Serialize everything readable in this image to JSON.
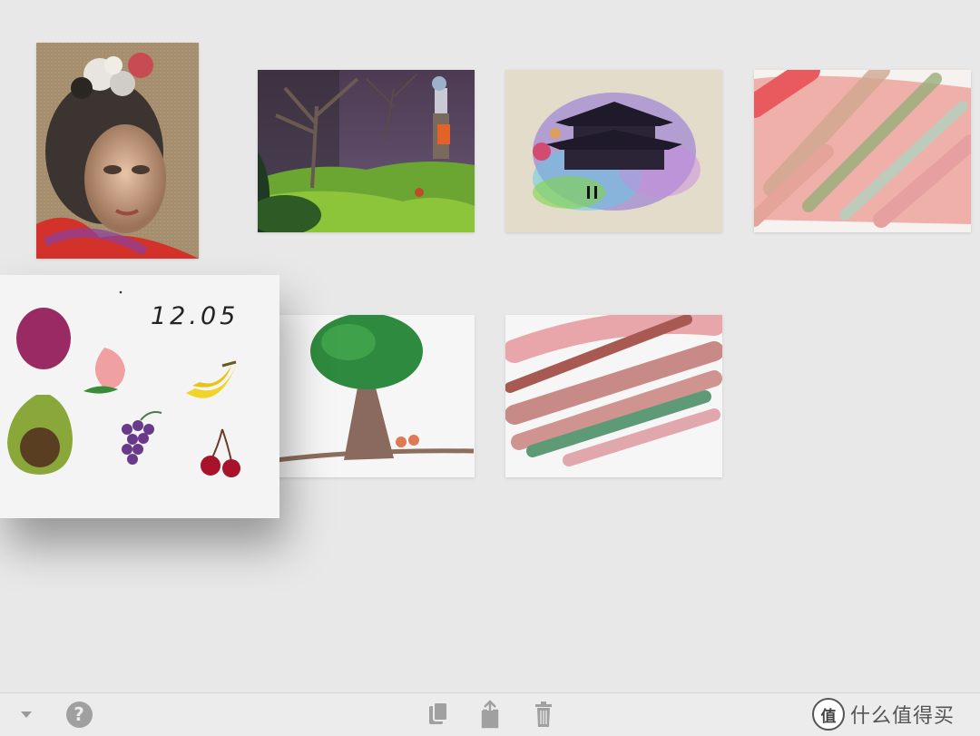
{
  "gallery": {
    "items": [
      {
        "name": "portrait-painting"
      },
      {
        "name": "forest-scene"
      },
      {
        "name": "temple-watercolor"
      },
      {
        "name": "pink-strokes"
      },
      {
        "name": "tree-drawing",
        "caption": "12.05"
      },
      {
        "name": "rose-green-strokes"
      }
    ],
    "lifted_item": {
      "date": "12.05"
    }
  },
  "toolbar": {
    "icons": [
      "chevron-down-icon",
      "help-icon",
      "duplicate-icon",
      "share-icon",
      "trash-icon"
    ],
    "help_label": "?",
    "brand_logo": "值",
    "brand_name": "什么值得买"
  },
  "colors": {
    "background": "#e8e8e8",
    "toolbar": "#ececec",
    "icon": "#9a9a9a"
  }
}
